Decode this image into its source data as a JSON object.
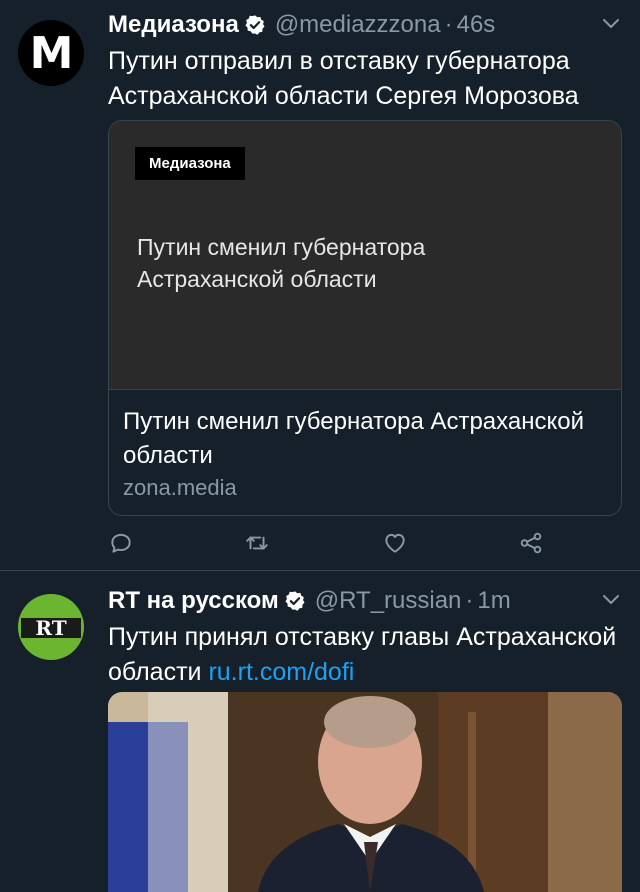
{
  "tweets": [
    {
      "display_name": "Медиазона",
      "handle": "@mediazzzona",
      "time": "46s",
      "avatar_letter": "M",
      "text": "Путин отправил в отставку губернатора Астраханской области Сергея Морозова",
      "card": {
        "brand_label": "Медиазона",
        "image_title": "Путин сменил губернатора Астраханской области",
        "title": "Путин сменил губернатора Астраханской области",
        "domain": "zona.media"
      },
      "actions": [
        "reply-icon",
        "retweet-icon",
        "like-icon",
        "share-icon"
      ]
    },
    {
      "display_name": "RT на русском",
      "handle": "@RT_russian",
      "time": "1m",
      "avatar_text": "RT",
      "text": "Путин принял отставку главы Астраханской области ",
      "link": "ru.rt.com/dofi"
    }
  ],
  "colors": {
    "background": "#15202b",
    "secondary_text": "#8899a6",
    "link": "#1da1f2",
    "divider": "#38444d",
    "verified_badge": "#ffffff",
    "rt_green": "#6bb530"
  }
}
